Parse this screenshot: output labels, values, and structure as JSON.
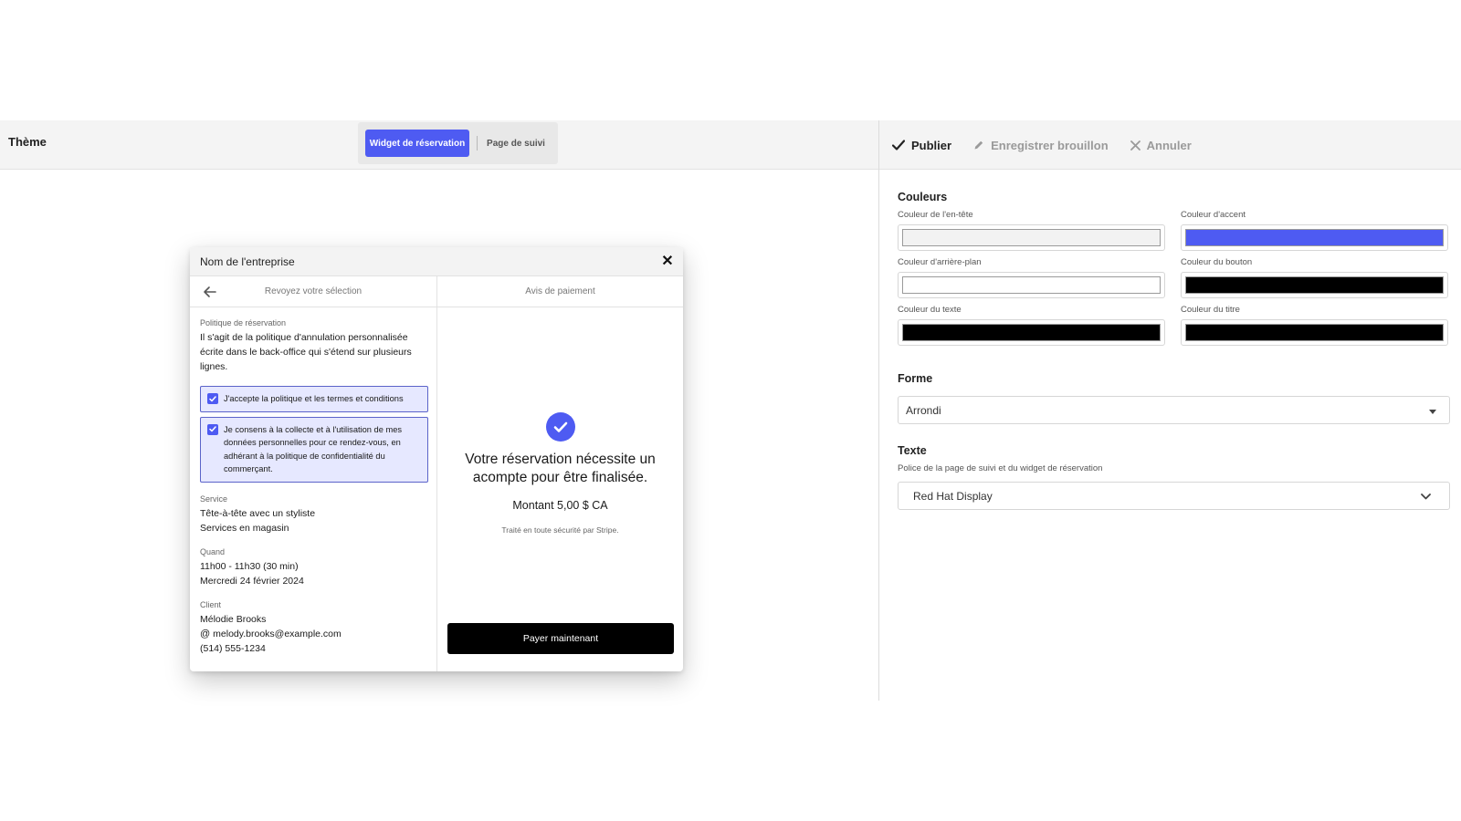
{
  "topbar": {
    "title": "Thème",
    "tabs": [
      {
        "label": "Widget de réservation",
        "active": true
      },
      {
        "label": "Page de suivi",
        "active": false
      }
    ],
    "actions": {
      "publish": "Publier",
      "save_draft": "Enregistrer brouillon",
      "cancel": "Annuler"
    }
  },
  "widget": {
    "company_name": "Nom de l'entreprise",
    "close_icon": "close-icon",
    "left_header": "Revoyez votre sélection",
    "right_header": "Avis de paiement",
    "policy_label": "Politique de réservation",
    "policy_text": "Il s'agit de la politique d'annulation personnalisée écrite dans le back-office qui s'étend sur plusieurs lignes.",
    "consent_terms": "J'accepte la politique et les termes et conditions",
    "consent_data": "Je consens à la collecte et à l'utilisation de mes données personnelles pour ce rendez-vous, en adhérant à la politique de confidentialité du commerçant.",
    "service_label": "Service",
    "service_name": "Tête-à-tête avec un styliste",
    "service_location": "Services en magasin",
    "when_label": "Quand",
    "when_time": "11h00 - 11h30 (30 min)",
    "when_date": "Mercredi 24 février 2024",
    "client_label": "Client",
    "client_name": "Mélodie Brooks",
    "client_email": "melody.brooks@example.com",
    "client_phone": "(514) 555-1234",
    "payment_title": "Votre réservation nécessite un acompte pour être finalisée.",
    "payment_amount": "Montant 5,00 $ CA",
    "payment_secure": "Traité en toute sécurité par Stripe.",
    "pay_button": "Payer maintenant"
  },
  "settings": {
    "colors_title": "Couleurs",
    "colors": [
      {
        "label": "Couleur de l'en-tête",
        "value": "#f2f2f2"
      },
      {
        "label": "Couleur d'accent",
        "value": "#4e5bf2"
      },
      {
        "label": "Couleur d'arrière-plan",
        "value": "#ffffff"
      },
      {
        "label": "Couleur du bouton",
        "value": "#000000"
      },
      {
        "label": "Couleur du texte",
        "value": "#000000"
      },
      {
        "label": "Couleur du titre",
        "value": "#000000"
      }
    ],
    "shape_title": "Forme",
    "shape_value": "Arrondi",
    "text_title": "Texte",
    "text_description": "Police de la page de suivi et du widget de réservation",
    "font_value": "Red Hat Display"
  }
}
